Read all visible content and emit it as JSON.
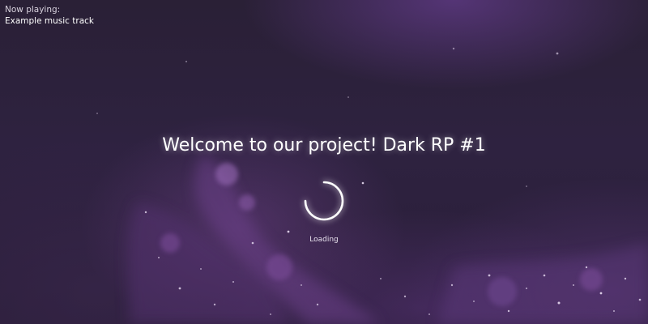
{
  "now_playing": {
    "label": "Now playing:",
    "track": "Example music track"
  },
  "welcome": {
    "title": "Welcome to our project! Dark RP #1"
  },
  "loading": {
    "label": "Loading",
    "spinner_icon": "loading-spinner-icon"
  },
  "colors": {
    "background": "#2e2240",
    "accent": "#8c50aa",
    "text": "#ffffff"
  }
}
